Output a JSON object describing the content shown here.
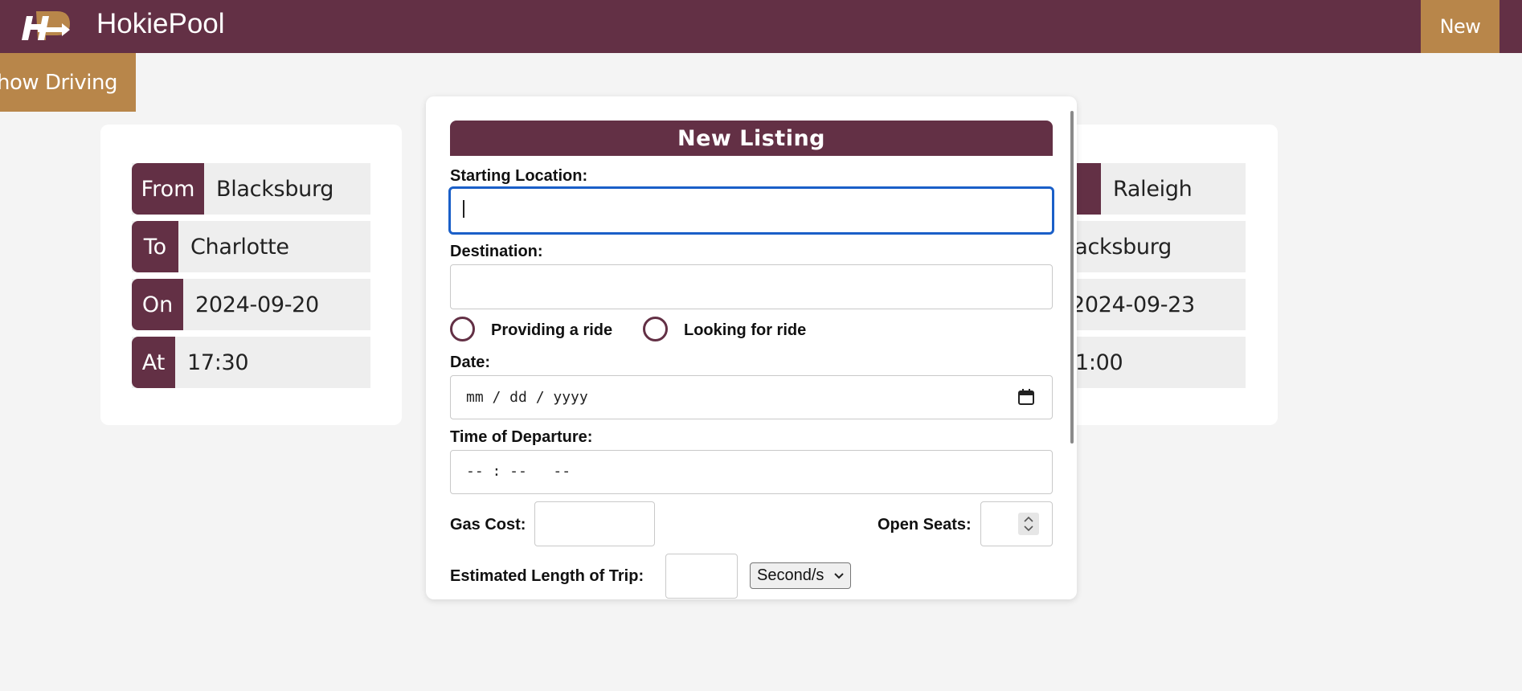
{
  "header": {
    "brand": "HokiePool",
    "new_button": "New",
    "colors": {
      "primary": "#633045",
      "accent": "#b8864a"
    }
  },
  "toggle_button": "show Driving",
  "cards": [
    {
      "rows": [
        {
          "key": "From",
          "value": "Blacksburg"
        },
        {
          "key": "To",
          "value": "Charlotte"
        },
        {
          "key": "On",
          "value": "2024-09-20"
        },
        {
          "key": "At",
          "value": "17:30"
        }
      ]
    },
    {
      "rows": [
        {
          "key": "",
          "value": "Raleigh"
        },
        {
          "key": "",
          "value": "lacksburg"
        },
        {
          "key": "",
          "value": "2024-09-23"
        },
        {
          "key": "",
          "value": "1:00"
        }
      ]
    }
  ],
  "modal": {
    "title": "New Listing",
    "starting_location_label": "Starting Location:",
    "starting_location_value": "",
    "destination_label": "Destination:",
    "destination_value": "",
    "radio_providing": "Providing a ride",
    "radio_looking": "Looking for ride",
    "date_label": "Date:",
    "date_placeholder": "mm / dd / yyyy",
    "time_label": "Time of Departure:",
    "time_placeholder": "-- : --   --",
    "gas_cost_label": "Gas Cost:",
    "open_seats_label": "Open Seats:",
    "trip_length_label": "Estimated Length of Trip:",
    "trip_unit": "Second/s"
  }
}
